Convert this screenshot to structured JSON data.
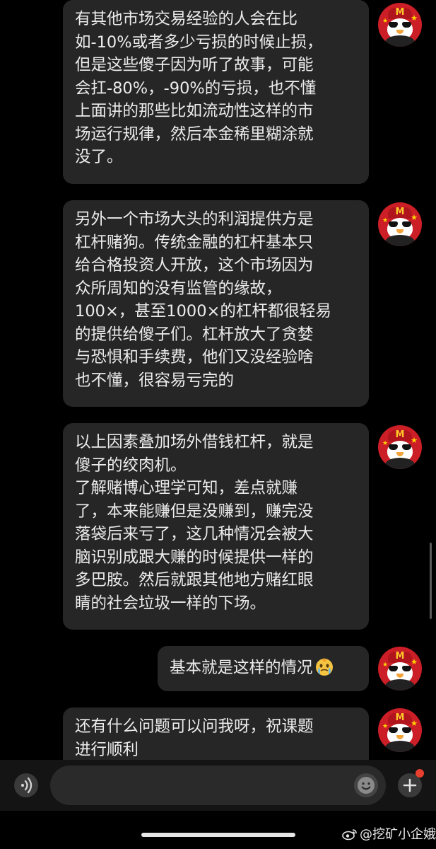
{
  "messages": [
    {
      "id": "m1",
      "lines": [
        "有其他市场交易经验的人会在比",
        "如-10%或者多少亏损的时候止损，",
        "但是这些傻子因为听了故事，可能",
        "会扛-80%，-90%的亏损，也不懂",
        "上面讲的那些比如流动性这样的市",
        "场运行规律，然后本金稀里糊涂就",
        "没了。"
      ]
    },
    {
      "id": "m2",
      "lines": [
        "另外一个市场大头的利润提供方是",
        "杠杆赌狗。传统金融的杠杆基本只",
        "给合格投资人开放，这个市场因为",
        "众所周知的没有监管的缘故，",
        "100×，甚至1000×的杠杆都很轻易",
        "的提供给傻子们。杠杆放大了贪婪",
        "与恐惧和手续费，他们又没经验啥",
        "也不懂，很容易亏完的"
      ]
    },
    {
      "id": "m3",
      "lines": [
        "以上因素叠加场外借钱杠杆，就是",
        "傻子的绞肉机。",
        "了解赌博心理学可知，差点就赚",
        "了，本来能赚但是没赚到，赚完没",
        "落袋后来亏了，这几种情况会被大",
        "脑识别成跟大赚的时候提供一样的",
        "多巴胺。然后就跟其他地方赌红眼",
        "睛的社会垃圾一样的下场。"
      ]
    },
    {
      "id": "m4",
      "lines": [
        "基本就是这样的情况"
      ],
      "sticker": "crying-face-sticker"
    },
    {
      "id": "m5",
      "lines": [
        "还有什么问题可以问我呀，祝课题",
        "进行顺利"
      ]
    }
  ],
  "avatar": {
    "hat_letter": "M",
    "icon": "penguin-mcdonalds-avatar"
  },
  "input_bar": {
    "voice_icon": "voice-icon",
    "emoji_icon": "emoji-icon",
    "plus_icon": "plus-icon"
  },
  "watermark": {
    "text": "@挖矿小企娥",
    "icon": "weibo-logo-icon"
  },
  "colors": {
    "background": "#000000",
    "bubble": "#262626",
    "text": "#ececec",
    "avatar_red": "#cc1e26",
    "notification_dot": "#e8402f"
  }
}
